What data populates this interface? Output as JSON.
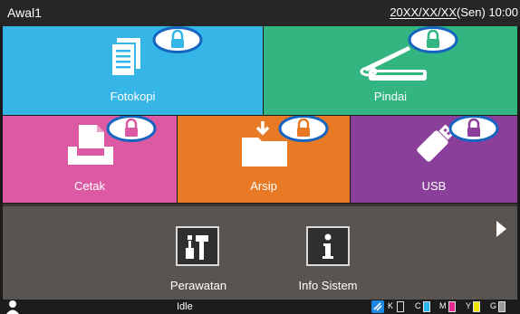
{
  "header": {
    "title": "Awal1",
    "date": "20XX/XX/XX",
    "day": "(Sen)",
    "time": "10:00"
  },
  "tiles": {
    "copy": {
      "label": "Fotokopi",
      "color": "#35b6e6",
      "locked": true
    },
    "scan": {
      "label": "Pindai",
      "color": "#32b581",
      "locked": true
    },
    "print": {
      "label": "Cetak",
      "color": "#dc5aa3",
      "locked": true
    },
    "store": {
      "label": "Arsip",
      "color": "#e87a26",
      "locked": true
    },
    "usb": {
      "label": "USB",
      "color": "#8a3f9a",
      "locked": true
    }
  },
  "tools": {
    "maintenance": {
      "label": "Perawatan",
      "icon": "tools-icon"
    },
    "info": {
      "label": "Info Sistem",
      "icon": "info-icon"
    }
  },
  "status": {
    "state": "Idle",
    "inks": [
      {
        "code": "K",
        "color": "#1c1c1c"
      },
      {
        "code": "C",
        "color": "#29b6ea"
      },
      {
        "code": "M",
        "color": "#e6288f"
      },
      {
        "code": "Y",
        "color": "#f2e600"
      },
      {
        "code": "G",
        "color": "#9a9a9a"
      }
    ]
  }
}
